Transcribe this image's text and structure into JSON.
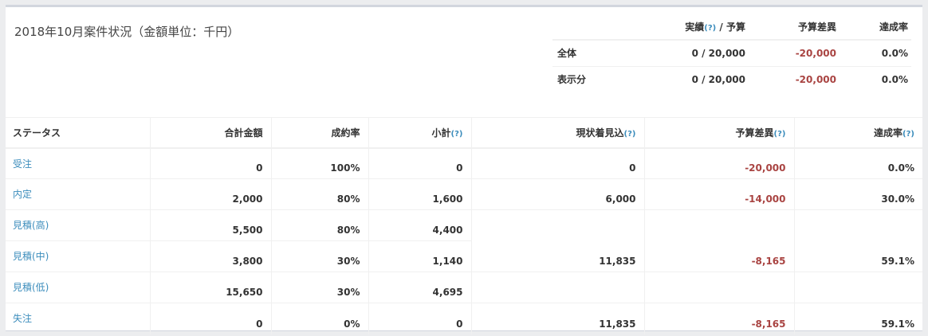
{
  "title": "2018年10月案件状況（金額単位：千円）",
  "summary": {
    "headers": {
      "actual": "実績",
      "help": "(?)",
      "budget_sep": " / 予算",
      "diff": "予算差異",
      "rate": "達成率"
    },
    "rows": [
      {
        "label": "全体",
        "actual_budget": "0 / 20,000",
        "diff": "-20,000",
        "rate": "0.0%"
      },
      {
        "label": "表示分",
        "actual_budget": "0 / 20,000",
        "diff": "-20,000",
        "rate": "0.0%"
      }
    ]
  },
  "main": {
    "headers": {
      "status": "ステータス",
      "total": "合計金額",
      "close_rate": "成約率",
      "subtotal": "小計",
      "forecast": "現状着見込",
      "budget_diff": "予算差異",
      "achievement": "達成率",
      "help": "(?)"
    },
    "rows": [
      {
        "status": "受注",
        "total": "0",
        "close_rate": "100%",
        "subtotal": "0",
        "forecast": "0",
        "diff": "-20,000",
        "rate": "0.0%"
      },
      {
        "status": "内定",
        "total": "2,000",
        "close_rate": "80%",
        "subtotal": "1,600",
        "forecast": "6,000",
        "diff": "-14,000",
        "rate": "30.0%"
      },
      {
        "status": "見積(高)",
        "total": "5,500",
        "close_rate": "80%",
        "subtotal": "4,400",
        "forecast": "",
        "diff": "",
        "rate": ""
      },
      {
        "status": "見積(中)",
        "total": "3,800",
        "close_rate": "30%",
        "subtotal": "1,140",
        "forecast": "11,835",
        "diff": "-8,165",
        "rate": "59.1%"
      },
      {
        "status": "見積(低)",
        "total": "15,650",
        "close_rate": "30%",
        "subtotal": "4,695",
        "forecast": "",
        "diff": "",
        "rate": ""
      },
      {
        "status": "失注",
        "total": "0",
        "close_rate": "0%",
        "subtotal": "0",
        "forecast": "11,835",
        "diff": "-8,165",
        "rate": "59.1%"
      }
    ]
  }
}
